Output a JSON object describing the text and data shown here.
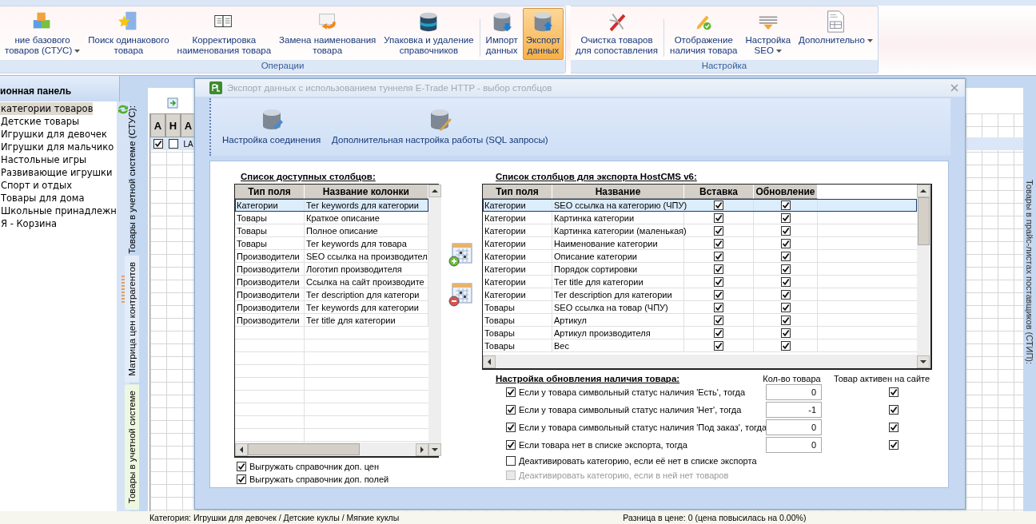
{
  "ribbon": {
    "groups": [
      {
        "label": "Операции",
        "buttons": [
          {
            "lines": [
              "ние базового",
              "товаров (СТУС)"
            ],
            "dropdown": true,
            "selected": false
          },
          {
            "lines": [
              "Поиск одинакового",
              "товара"
            ],
            "dropdown": false,
            "selected": false
          },
          {
            "lines": [
              "Корректировка",
              "наименования товара"
            ],
            "dropdown": false,
            "selected": false
          },
          {
            "lines": [
              "Замена наименования",
              "товара"
            ],
            "dropdown": false,
            "selected": false
          },
          {
            "lines": [
              "Упаковка и удаление",
              "справочников"
            ],
            "dropdown": false,
            "selected": false
          },
          {
            "lines": [
              "Импорт",
              "данных"
            ],
            "dropdown": false,
            "selected": false
          },
          {
            "lines": [
              "Экспорт",
              "данных"
            ],
            "dropdown": false,
            "selected": true
          }
        ]
      },
      {
        "label": "Настройка",
        "buttons": [
          {
            "lines": [
              "Очистка товаров",
              "для сопоставления"
            ],
            "dropdown": false,
            "selected": false
          },
          {
            "lines": [
              "Отображение",
              "наличия товара"
            ],
            "dropdown": false,
            "selected": false
          },
          {
            "lines": [
              "Настройка",
              "SEO"
            ],
            "dropdown": true,
            "selected": false
          },
          {
            "lines": [
              "Дополнительно"
            ],
            "dropdown": true,
            "selected": false
          }
        ]
      }
    ]
  },
  "navigation": {
    "title": "ионная панель",
    "items": [
      {
        "label": "категории товаров",
        "selected": true
      },
      {
        "label": "Детские товары",
        "selected": false
      },
      {
        "label": "Игрушки для девочек",
        "selected": false
      },
      {
        "label": "Игрушки для мальчико",
        "selected": false
      },
      {
        "label": "Настольные игры",
        "selected": false
      },
      {
        "label": "Развивающие игрушки",
        "selected": false
      },
      {
        "label": "Спорт и отдых",
        "selected": false
      },
      {
        "label": "Товары для дома",
        "selected": false
      },
      {
        "label": "Школьные принадлежн",
        "selected": false
      },
      {
        "label": "Я - Корзина",
        "selected": false
      }
    ]
  },
  "workspace": {
    "caption": "Товары в учетной системе (СТУС):",
    "vertical_tabs": [
      {
        "label": "Матрица цен контрагентов",
        "selected": false
      },
      {
        "label": "Товары в учетной системе",
        "selected": true
      }
    ],
    "grid": {
      "columns": [
        "А",
        "Н",
        "А"
      ],
      "rows": [
        {
          "column_1": true,
          "column_2": false,
          "column_3": "LA"
        }
      ]
    },
    "side_caption": "Товары в прайс-листах поставщиков (СТИП):"
  },
  "status_bar": {
    "category": "Категория: Игрушки для девочек / Детские куклы / Мягкие куклы",
    "price_difference": "Разница в цене: 0  (цена повысилась на 0.00%)"
  },
  "dialog": {
    "title": "Экспорт данных с использованием туннеля E-Trade HTTP - выбор столбцов",
    "active": false,
    "toolbar": [
      "Настройка соединения",
      "Дополнительная настройка работы (SQL запросы)"
    ],
    "available": {
      "title": "Список доступных столбцов:",
      "columns": [
        "Тип поля",
        "Название колонки"
      ],
      "rows": [
        {
          "cells": [
            "Категории",
            "Тег keywords для категории"
          ],
          "selected": true
        },
        {
          "cells": [
            "Товары",
            "Краткое описание"
          ],
          "selected": false
        },
        {
          "cells": [
            "Товары",
            "Полное описание"
          ],
          "selected": false
        },
        {
          "cells": [
            "Товары",
            "Тег keywords для товара"
          ],
          "selected": false
        },
        {
          "cells": [
            "Производители",
            "SEO ссылка на производител"
          ],
          "selected": false
        },
        {
          "cells": [
            "Производители",
            "Логотип производителя"
          ],
          "selected": false
        },
        {
          "cells": [
            "Производители",
            "Ссылка на сайт производите"
          ],
          "selected": false
        },
        {
          "cells": [
            "Производители",
            "Тег description для категори"
          ],
          "selected": false
        },
        {
          "cells": [
            "Производители",
            "Тег keywords для категории"
          ],
          "selected": false
        },
        {
          "cells": [
            "Производители",
            "Тег title для категории"
          ],
          "selected": false
        }
      ],
      "options": [
        {
          "label": "Выгружать справочник доп. цен",
          "checked": true
        },
        {
          "label": "Выгружать справочник доп. полей",
          "checked": true
        }
      ]
    },
    "export": {
      "title": "Список столбцов для экспорта HostCMS v6:",
      "columns": [
        "Тип поля",
        "Название",
        "Вставка",
        "Обновление"
      ],
      "rows": [
        {
          "cells": [
            "Категории",
            "SEO ссылка на категорию (ЧПУ)"
          ],
          "insert": true,
          "update": true,
          "selected": true
        },
        {
          "cells": [
            "Категории",
            "Картинка категории"
          ],
          "insert": true,
          "update": true,
          "selected": false
        },
        {
          "cells": [
            "Категории",
            "Картинка категории (маленькая)"
          ],
          "insert": true,
          "update": true,
          "selected": false
        },
        {
          "cells": [
            "Категории",
            "Наименование категории"
          ],
          "insert": true,
          "update": true,
          "selected": false
        },
        {
          "cells": [
            "Категории",
            "Описание категории"
          ],
          "insert": true,
          "update": true,
          "selected": false
        },
        {
          "cells": [
            "Категории",
            "Порядок сортировки"
          ],
          "insert": true,
          "update": true,
          "selected": false
        },
        {
          "cells": [
            "Категории",
            "Тег title для категории"
          ],
          "insert": true,
          "update": true,
          "selected": false
        },
        {
          "cells": [
            "Категории",
            "Тег description для категории"
          ],
          "insert": true,
          "update": true,
          "selected": false
        },
        {
          "cells": [
            "Товары",
            "SEO ссылка на товар (ЧПУ)"
          ],
          "insert": true,
          "update": true,
          "selected": false
        },
        {
          "cells": [
            "Товары",
            "Артикул"
          ],
          "insert": true,
          "update": true,
          "selected": false
        },
        {
          "cells": [
            "Товары",
            "Артикул производителя"
          ],
          "insert": true,
          "update": true,
          "selected": false
        },
        {
          "cells": [
            "Товары",
            "Вес"
          ],
          "insert": true,
          "update": true,
          "selected": false
        }
      ]
    },
    "availability": {
      "title": "Настройка обновления наличия товара:",
      "quantity_header": "Кол-во товара",
      "active_header": "Товар активен на сайте",
      "rows": [
        {
          "kind": "threshold",
          "label": "Если у товара символьный статус наличия 'Есть', тогда",
          "checked": true,
          "quantity": "0",
          "active": true
        },
        {
          "kind": "threshold",
          "label": "Если у товара символьный статус наличия 'Нет', тогда",
          "checked": true,
          "quantity": "-1",
          "active": true
        },
        {
          "kind": "threshold",
          "label": "Если у товара символьный статус наличия 'Под заказ', тогда",
          "checked": true,
          "quantity": "0",
          "active": true
        },
        {
          "kind": "threshold",
          "label": "Если товара нет в списке экспорта, тогда",
          "checked": true,
          "quantity": "0",
          "active": true
        },
        {
          "kind": "option",
          "label": "Деактивировать категорию, если её нет в списке экспорта",
          "checked": false,
          "disabled": false
        },
        {
          "kind": "option",
          "label": "Деактивировать категорию, если в ней нет товаров",
          "checked": false,
          "disabled": true
        }
      ]
    }
  }
}
